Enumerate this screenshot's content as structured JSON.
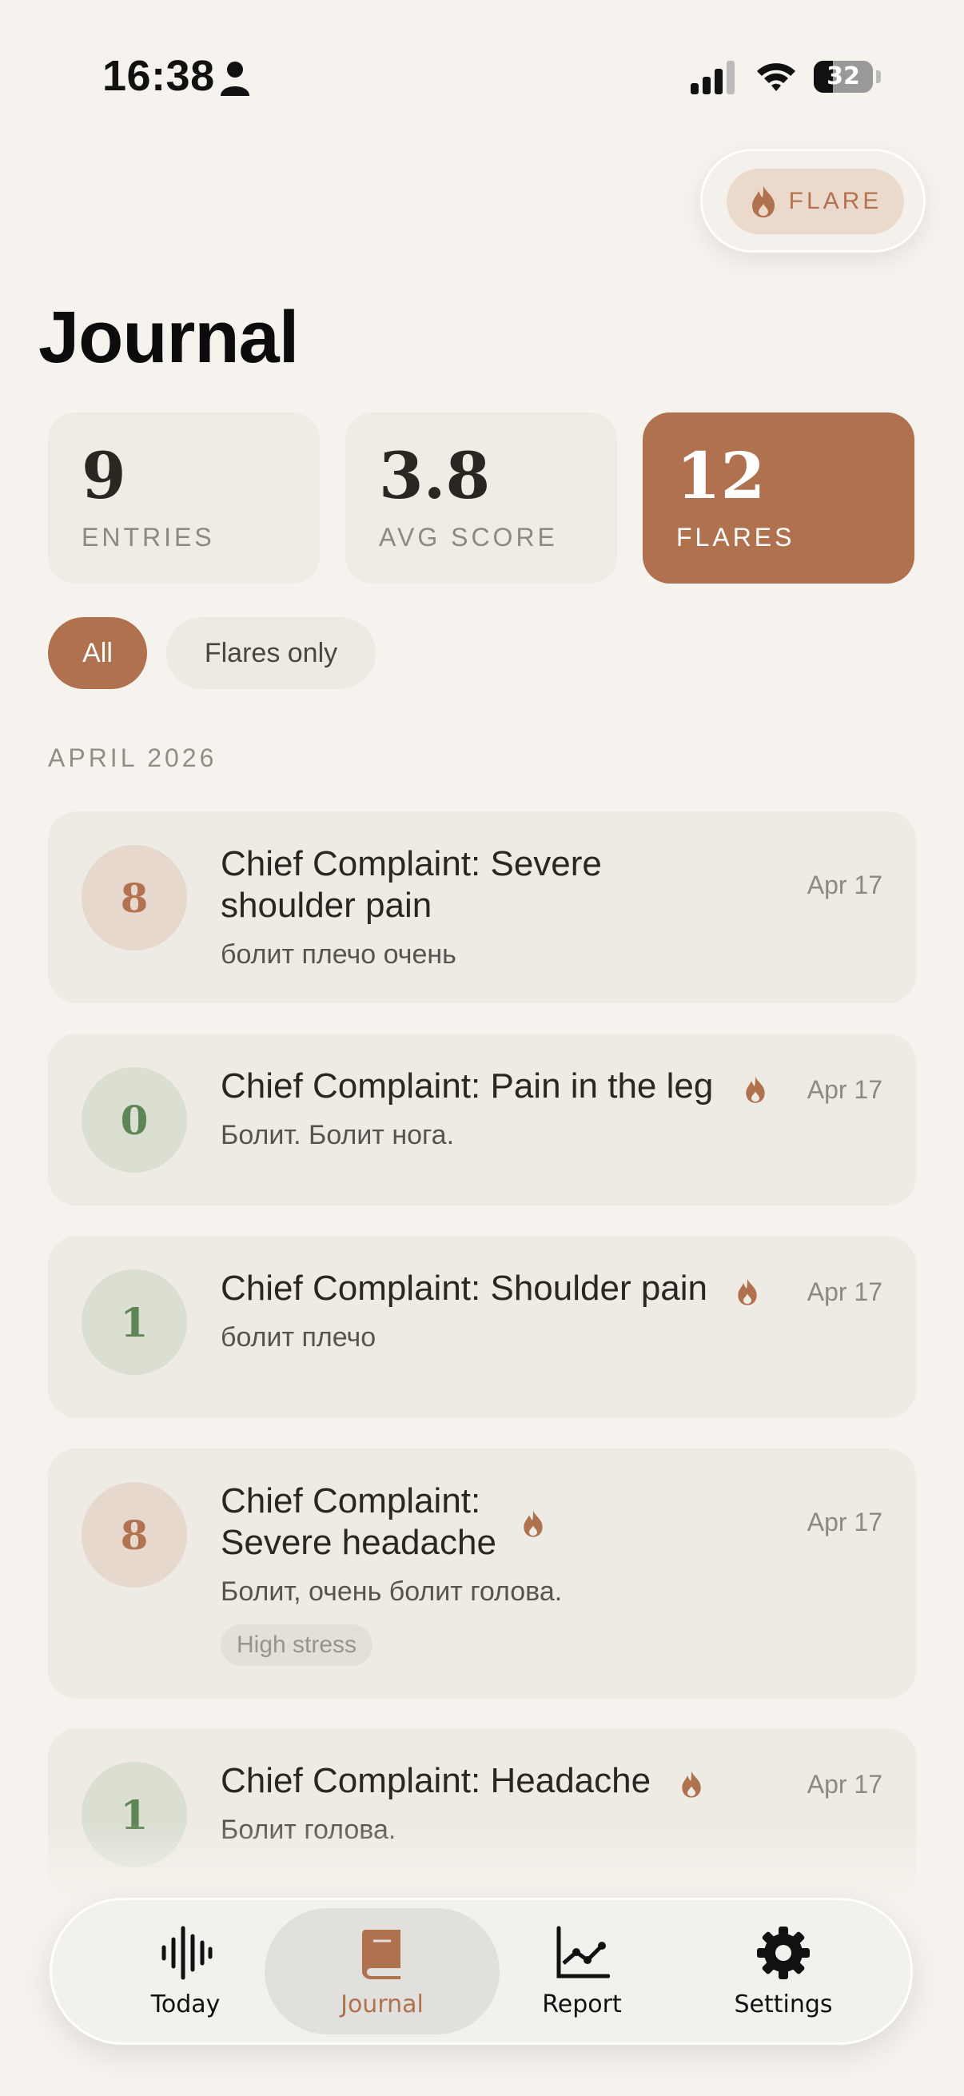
{
  "status_bar": {
    "time": "16:38",
    "battery": "32",
    "battery_level": 0.32
  },
  "flare_button": {
    "label": "FLARE",
    "icon": "flame-icon"
  },
  "page_title": "Journal",
  "stats": [
    {
      "value": "9",
      "label": "ENTRIES"
    },
    {
      "value": "3.8",
      "label": "AVG SCORE"
    },
    {
      "value": "12",
      "label": "FLARES"
    }
  ],
  "filters": {
    "all": "All",
    "flares_only": "Flares only",
    "selected": "All"
  },
  "month_header": "APRIL 2026",
  "entries": [
    {
      "score": "8",
      "title_line1": "Chief Complaint: Severe",
      "title_line2": "shoulder pain",
      "subtitle": "болит плечо очень",
      "date": "Apr 17",
      "flare": false
    },
    {
      "score": "0",
      "title_line1": "Chief Complaint: Pain in the leg",
      "subtitle": "Болит. Болит нога.",
      "date": "Apr 17",
      "flare": true
    },
    {
      "score": "1",
      "title_line1": "Chief Complaint: Shoulder pain",
      "subtitle": "болит плечо",
      "date": "Apr 17",
      "flare": true
    },
    {
      "score": "8",
      "title_line1": "Chief Complaint:",
      "title_line2": "Severe headache",
      "subtitle": "Болит, очень болит голова.",
      "date": "Apr 17",
      "flare": true,
      "tag": "High stress"
    },
    {
      "score": "1",
      "title_line1": "Chief Complaint: Headache",
      "subtitle": "Болит голова.",
      "date": "Apr 17",
      "flare": true
    }
  ],
  "tabs": [
    {
      "label": "Today",
      "icon": "waveform-icon"
    },
    {
      "label": "Journal",
      "icon": "book-icon",
      "active": true
    },
    {
      "label": "Report",
      "icon": "chart-icon"
    },
    {
      "label": "Settings",
      "icon": "gear-icon"
    }
  ],
  "colors": {
    "accent": "#B0714E",
    "background": "#F6F3EE",
    "card": "#EEEAE4",
    "score_high": "#B47350",
    "score_low": "#5E8556"
  }
}
